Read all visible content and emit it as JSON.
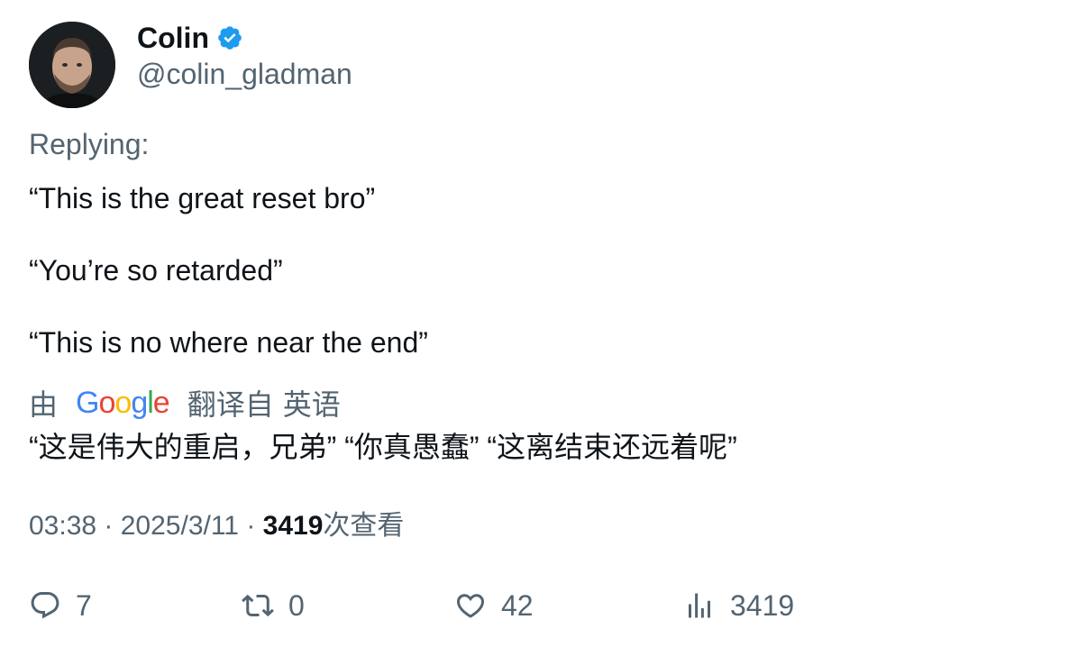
{
  "author": {
    "display_name": "Colin",
    "handle": "@colin_gladman",
    "verified_color": "#1d9bf0"
  },
  "reply_context": "Replying:",
  "body_lines": [
    "“This is the great reset bro”",
    "“You’re so retarded”",
    "“This is no where near the end”"
  ],
  "translation": {
    "prefix": "由",
    "provider_letters": [
      "G",
      "o",
      "o",
      "g",
      "l",
      "e"
    ],
    "provider_colors": [
      "#4285F4",
      "#EA4335",
      "#FBBC05",
      "#4285F4",
      "#34A853",
      "#EA4335"
    ],
    "suffix": "翻译自",
    "language": "英语",
    "text": "“这是伟大的重启，兄弟” “你真愚蠢” “这离结束还远着呢”"
  },
  "meta": {
    "time": "03:38",
    "separator": " · ",
    "date": "2025/3/11",
    "views_count": "3419",
    "views_label": "次查看"
  },
  "actions": {
    "reply_count": "7",
    "retweet_count": "0",
    "like_count": "42",
    "views_count": "3419",
    "icons": [
      "reply-icon",
      "retweet-icon",
      "like-icon",
      "analytics-icon"
    ]
  }
}
